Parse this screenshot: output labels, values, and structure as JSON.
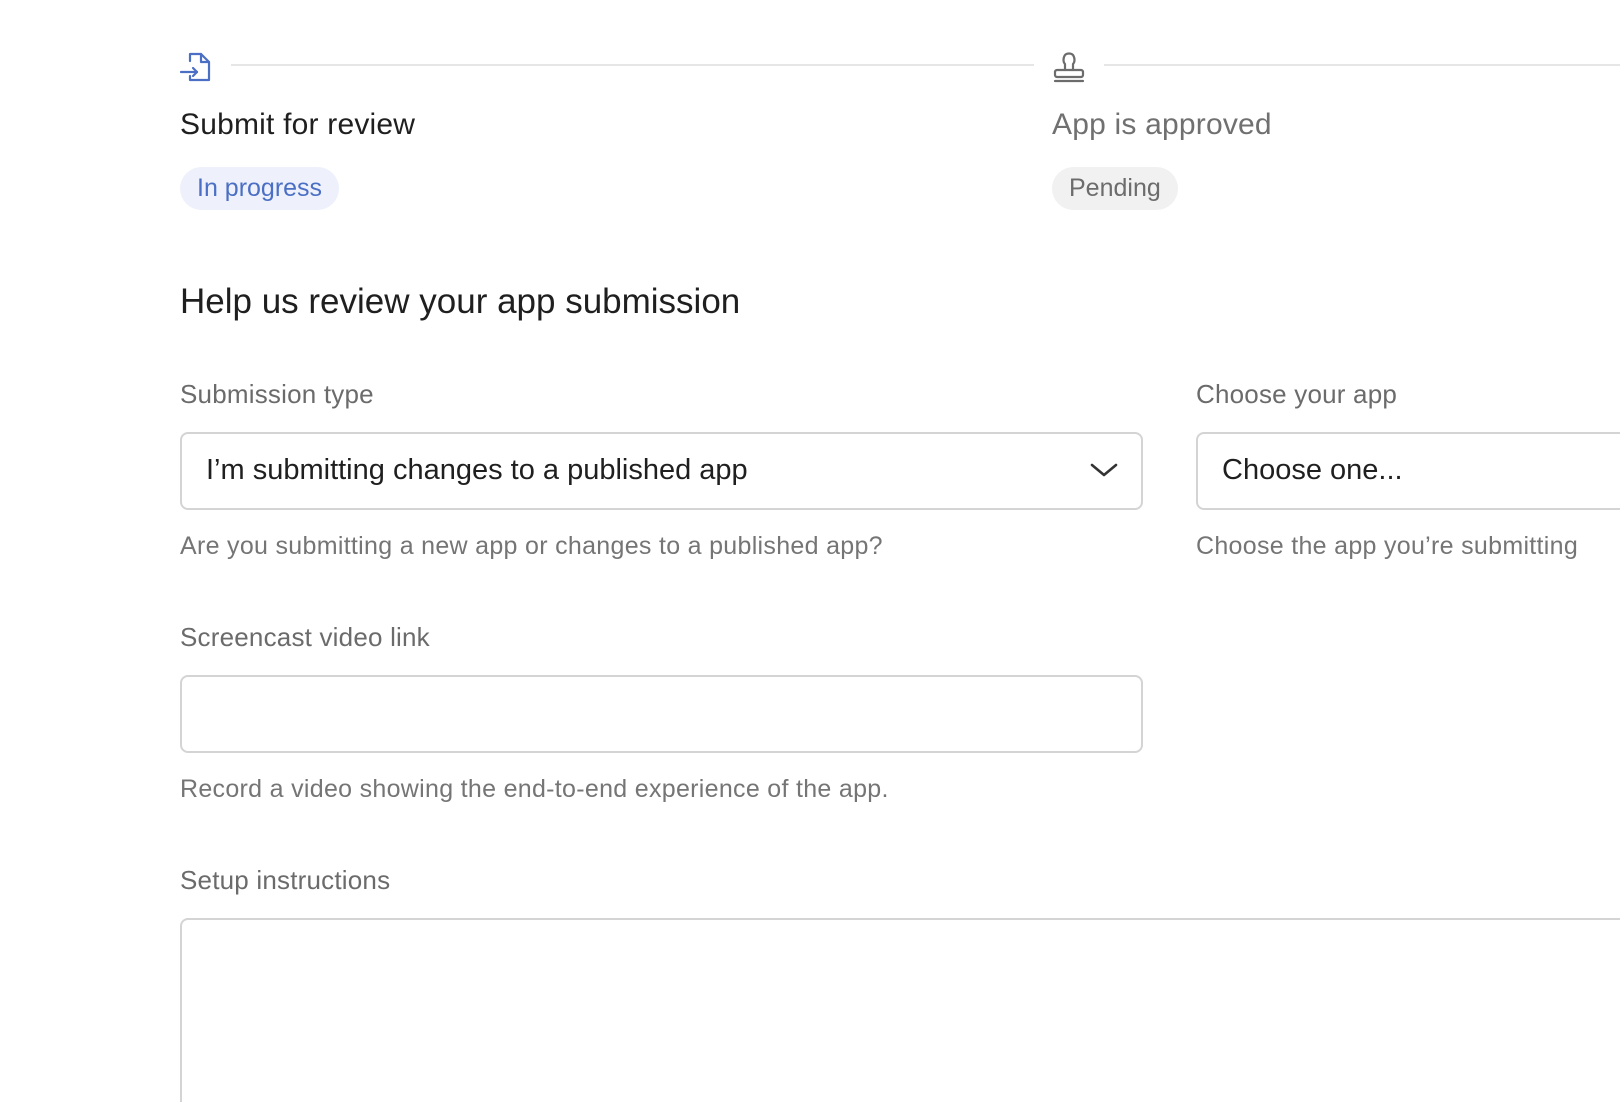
{
  "stepper": {
    "steps": [
      {
        "title": "Submit for review",
        "status": "In progress",
        "icon": "file-export-icon",
        "color": "#4a6fc4"
      },
      {
        "title": "App is approved",
        "status": "Pending",
        "icon": "stamp-icon",
        "color": "#707070"
      }
    ]
  },
  "form": {
    "heading": "Help us review your app submission",
    "submission_type": {
      "label": "Submission type",
      "value": "I’m submitting changes to a published app",
      "help": "Are you submitting a new app or changes to a published app?"
    },
    "choose_app": {
      "label": "Choose your app",
      "value": "Choose one...",
      "help": "Choose the app you’re submitting"
    },
    "screencast": {
      "label": "Screencast video link",
      "value": "",
      "help": "Record a video showing the end-to-end experience of the app."
    },
    "setup": {
      "label": "Setup instructions",
      "value": ""
    }
  },
  "colors": {
    "accent": "#4a6fc4",
    "border": "#d4d4d4",
    "muted_text": "#6b6b6b"
  }
}
